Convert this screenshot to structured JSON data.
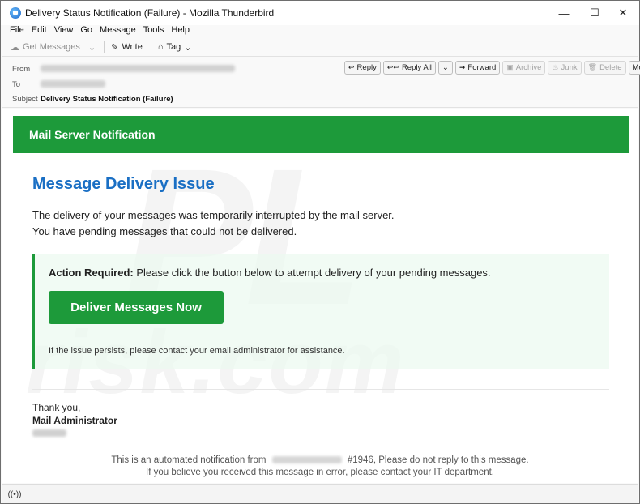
{
  "window": {
    "title": "Delivery Status Notification (Failure) - Mozilla Thunderbird",
    "controls": {
      "minimize": "—",
      "maximize": "☐",
      "close": "✕"
    }
  },
  "menu": [
    "File",
    "Edit",
    "View",
    "Go",
    "Message",
    "Tools",
    "Help"
  ],
  "toolbar": {
    "get_messages": "Get Messages",
    "write": "Write",
    "tag": "Tag"
  },
  "header": {
    "from_label": "From",
    "to_label": "To",
    "subject_label": "Subject",
    "subject": "Delivery Status Notification (Failure)",
    "actions": {
      "reply": "Reply",
      "reply_all": "Reply All",
      "forward": "Forward",
      "archive": "Archive",
      "junk": "Junk",
      "delete": "Delete",
      "more": "More"
    }
  },
  "email": {
    "banner": "Mail Server Notification",
    "heading": "Message Delivery Issue",
    "line1": "The delivery of your messages was temporarily interrupted by the mail server.",
    "line2": "You have pending messages that could not be delivered.",
    "action_required_label": "Action Required:",
    "action_required_text": " Please click the button below to attempt delivery of your pending messages.",
    "button": "Deliver Messages Now",
    "persist_note": "If the issue persists, please contact your email administrator for assistance.",
    "thanks": "Thank you,",
    "signature": "Mail Administrator",
    "footer_prefix": "This is an automated notification from",
    "footer_suffix": "#1946, Please do not reply to this message.",
    "footer_line2": "If you believe you received this message in error, please contact your IT department."
  },
  "watermark": {
    "line1": "PL",
    "line2": "risk.com"
  },
  "colors": {
    "banner_green": "#1d9a3a",
    "heading_blue": "#1a6fc4",
    "button_green": "#1d9a3a"
  }
}
